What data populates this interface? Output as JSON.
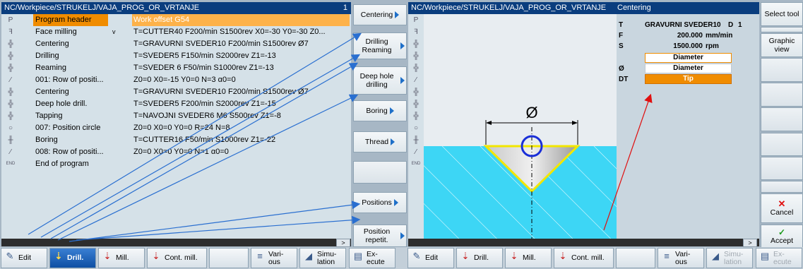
{
  "left": {
    "title": "NC/Workpiece/STRUKELJ/VAJA_PROG_OR_VRTANJE",
    "channel": "1",
    "rows": [
      {
        "icon": "P",
        "name": "Program header",
        "v": "",
        "detail": "Work offset G54",
        "selected": true
      },
      {
        "icon": "ꟻ",
        "name": "Face milling",
        "v": "v",
        "detail": "T=CUTTER40 F200/min S1500rev X0=-30 Y0=-30 Z0...",
        "selected": false
      },
      {
        "icon": "╬",
        "name": "Centering",
        "v": "",
        "detail": "T=GRAVURNI SVEDER10 F200/min S1500rev Ø7",
        "selected": false
      },
      {
        "icon": "╬",
        "name": "Drilling",
        "v": "",
        "detail": "T=SVEDER5 F150/min S2000rev Z1=-13",
        "selected": false
      },
      {
        "icon": "╬",
        "name": "Reaming",
        "v": "",
        "detail": "T=SVEDER 6 F50/min S1000rev Z1=-13",
        "selected": false
      },
      {
        "icon": "⁄",
        "name": "001: Row of positi...",
        "v": "",
        "detail": "Z0=0 X0=-15 Y0=0 N=3 α0=0",
        "selected": false
      },
      {
        "icon": "╬",
        "name": "Centering",
        "v": "",
        "detail": "T=GRAVURNI SVEDER10 F200/min S1500rev Ø7",
        "selected": false
      },
      {
        "icon": "╬",
        "name": "Deep hole drill.",
        "v": "",
        "detail": "T=SVEDER5 F200/min S2000rev Z1=-15",
        "selected": false
      },
      {
        "icon": "╬",
        "name": "Tapping",
        "v": "",
        "detail": "T=NAVOJNI SVEDER6 M6 S500rev Z1=-8",
        "selected": false
      },
      {
        "icon": "○",
        "name": "007: Position circle",
        "v": "",
        "detail": "Z0=0 X0=0 Y0=0 R=24 N=8",
        "selected": false
      },
      {
        "icon": "╫",
        "name": "Boring",
        "v": "",
        "detail": "T=CUTTER16 F50/min S1000rev Z1=-22",
        "selected": false
      },
      {
        "icon": "⁄",
        "name": "008: Row of positi...",
        "v": "",
        "detail": "Z0=0 X0=0 Y0=0 N=1 α0=0",
        "selected": false
      },
      {
        "icon": "END",
        "name": "End of program",
        "v": "",
        "detail": "",
        "selected": false
      }
    ],
    "vsoftkeys": [
      "Centering",
      "Drilling Reaming",
      "Deep hole drilling",
      "Boring",
      "Thread",
      "",
      "Positions",
      "Position repetit."
    ],
    "hsoftkeys": [
      "Edit",
      "Drill.",
      "Mill.",
      "Cont. mill.",
      "",
      "Vari- ous",
      "Simu- lation",
      "Ex- ecute"
    ]
  },
  "right": {
    "title": "NC/Workpiece/STRUKELJ/VAJA_PROG_OR_VRTANJE",
    "panel_title": "Centering",
    "icons": [
      "P",
      "ꟻ",
      "╬",
      "╬",
      "╬",
      "⁄",
      "╬",
      "╬",
      "╬",
      "○",
      "╫",
      "⁄",
      "END"
    ],
    "params": {
      "t_label": "T",
      "t_value": "GRAVURNI SVEDER10",
      "d_label": "D",
      "d_value": "1",
      "f_label": "F",
      "f_value": "200.000",
      "f_unit": "mm/min",
      "s_label": "S",
      "s_value": "1500.000",
      "s_unit": "rpm",
      "mode1": "Diameter",
      "dia_label": "Ø",
      "dia_value": "Diameter",
      "dt_label": "DT",
      "dt_value": "Tip"
    },
    "graphic_symbol": "Ø",
    "vsoftkeys": [
      "Select tool",
      "",
      "Graphic view",
      "",
      "",
      "",
      "",
      "",
      "",
      "Cancel",
      "Accept"
    ],
    "hsoftkeys": [
      "Edit",
      "Drill.",
      "Mill.",
      "Cont. mill.",
      "",
      "Vari- ous",
      "Simu- lation",
      "Ex- ecute"
    ]
  },
  "colors": {
    "titlebar": "#0a3d7e",
    "selected": "#f08c00",
    "material": "#3dd6f5",
    "accent": "#1e6fc8",
    "arrow_red": "#e01010"
  }
}
